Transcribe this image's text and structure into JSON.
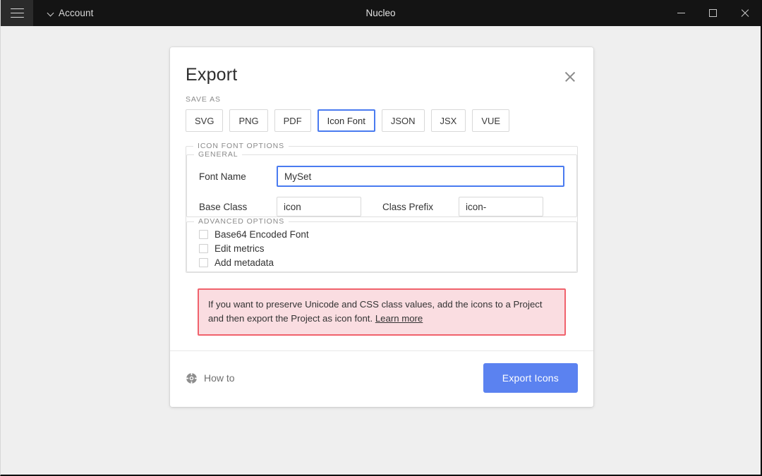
{
  "titlebar": {
    "menu_icon": "hamburger-icon",
    "account_label": "Account",
    "account_chevron_icon": "chevron-down-icon",
    "window_title": "Nucleo",
    "minimize_label": "–",
    "maximize_label": "□",
    "close_label": "×"
  },
  "dialog": {
    "title": "Export",
    "close_icon": "close-icon",
    "save_as_label": "SAVE AS",
    "formats": [
      {
        "label": "SVG",
        "selected": false
      },
      {
        "label": "PNG",
        "selected": false
      },
      {
        "label": "PDF",
        "selected": false
      },
      {
        "label": "Icon Font",
        "selected": true
      },
      {
        "label": "JSON",
        "selected": false
      },
      {
        "label": "JSX",
        "selected": false
      },
      {
        "label": "VUE",
        "selected": false
      }
    ],
    "options_legend": "ICON FONT OPTIONS",
    "general_legend": "GENERAL",
    "fields": {
      "font_name_label": "Font Name",
      "font_name_value": "MySet",
      "font_name_placeholder": "Font Name",
      "base_class_label": "Base Class",
      "base_class_value": "icon",
      "base_class_placeholder": "Base Class",
      "class_prefix_label": "Class Prefix",
      "class_prefix_value": "icon-",
      "class_prefix_placeholder": "Class Prefix"
    },
    "advanced_legend": "ADVANCED OPTIONS",
    "advanced_options": [
      {
        "label": "Base64 Encoded Font",
        "checked": false
      },
      {
        "label": "Edit metrics",
        "checked": false
      },
      {
        "label": "Add metadata",
        "checked": false
      }
    ],
    "alert": {
      "text": "If you want to preserve Unicode and CSS class values, add the icons to a Project and then export the Project as icon font.",
      "link_label": "Learn more"
    },
    "footer": {
      "how_to_label": "How to",
      "how_to_icon": "lifebuoy-icon",
      "export_label": "Export Icons"
    }
  },
  "colors": {
    "accent_blue": "#5b82f0",
    "selected_border": "#4a7bf0",
    "alert_bg": "#fadde1",
    "alert_border": "#f0626c",
    "titlebar_bg": "#141414",
    "page_bg": "#efefef"
  }
}
